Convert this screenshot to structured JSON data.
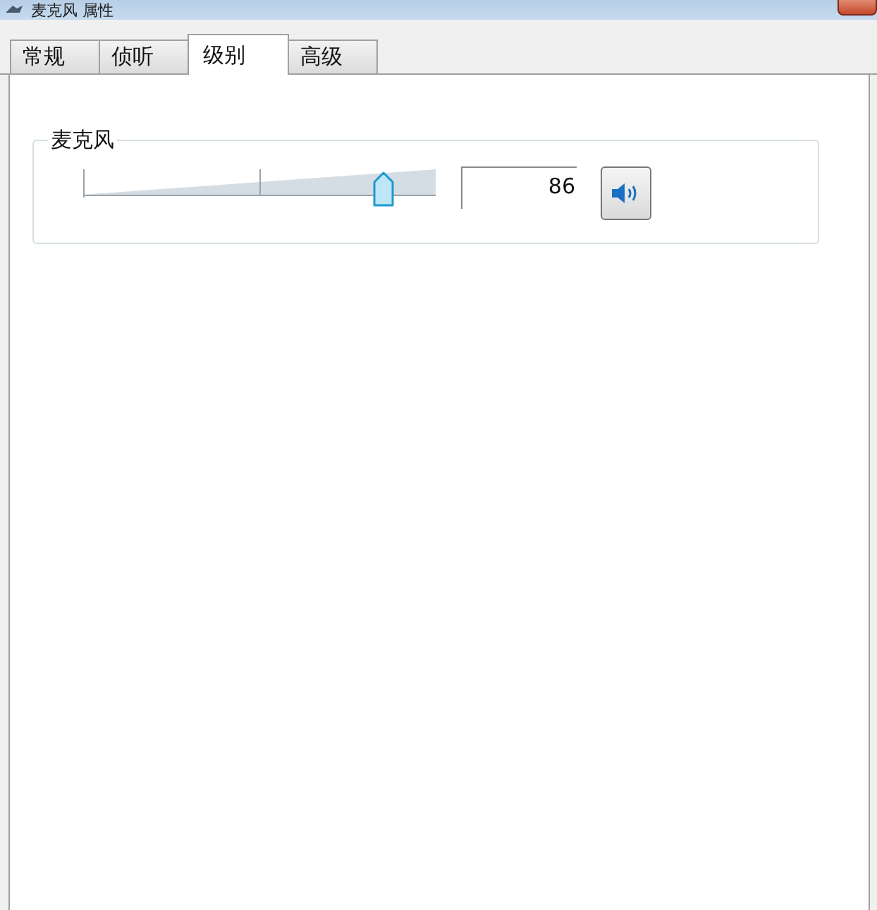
{
  "window": {
    "title": "麦克风 属性"
  },
  "tabs": [
    {
      "label": "常规",
      "selected": false
    },
    {
      "label": "侦听",
      "selected": false
    },
    {
      "label": "级别",
      "selected": true
    },
    {
      "label": "高级",
      "selected": false
    }
  ],
  "group": {
    "title": "麦克风",
    "slider": {
      "level": 0.85
    },
    "value": "86",
    "muted": false
  }
}
